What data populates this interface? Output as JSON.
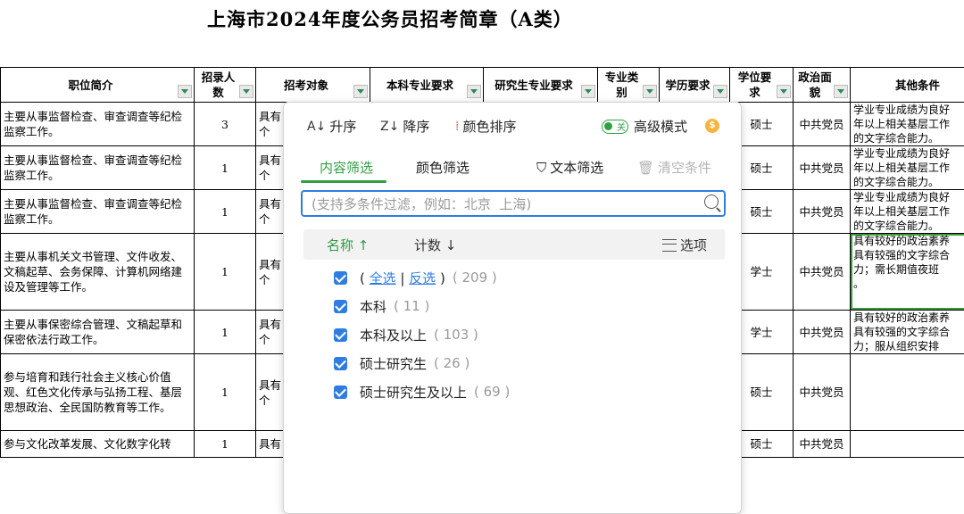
{
  "doc_title": "上海市2024年度公务员招考简章（A类）",
  "headers": [
    "职位简介",
    "招录人数",
    "招考对象",
    "本科专业要求",
    "研究生专业要求",
    "专业类别",
    "学历要求",
    "学位要求",
    "政治面貌",
    "其他条件"
  ],
  "rows": [
    {
      "desc": "主要从事监督检查、审查调查等纪检监察工作。",
      "num": "3",
      "target": "具有\n个",
      "degree": "硕士",
      "party": "中共党员",
      "other": "学业专业成绩为良好\n年以上相关基层工作\n的文字综合能力。"
    },
    {
      "desc": "主要从事监督检查、审查调查等纪检监察工作。",
      "num": "1",
      "target": "具有\n个",
      "degree": "硕士",
      "party": "中共党员",
      "other": "学业专业成绩为良好\n年以上相关基层工作\n的文字综合能力。"
    },
    {
      "desc": "主要从事监督检查、审查调查等纪检监察工作。",
      "num": "1",
      "target": "具有\n个",
      "degree": "硕士",
      "party": "中共党员",
      "other": "学业专业成绩为良好\n年以上相关基层工作\n的文字综合能力。"
    },
    {
      "desc": "主要从事机关文书管理、文件收发、文稿起草、会务保障、计算机网络建设及管理等工作。",
      "num": "1",
      "target": "具有\n个",
      "degree": "学士",
      "party": "中共党员",
      "other": "具有较好的政治素养\n具有较强的文字综合\n力；需长期值夜班\n。"
    },
    {
      "desc": "主要从事保密综合管理、文稿起草和保密依法行政工作。",
      "num": "1",
      "target": "具有\n个",
      "degree": "学士",
      "party": "中共党员",
      "other": "具有较好的政治素养\n具有较强的文字综合\n力；服从组织安排"
    },
    {
      "desc": "参与培育和践行社会主义核心价值观、红色文化传承与弘扬工程、基层思想政治、全民国防教育等工作。",
      "num": "1",
      "target": "具有\n个",
      "degree": "硕士",
      "party": "中共党员",
      "other": ""
    },
    {
      "desc": "参与文化改革发展、文化数字化转",
      "num": "1",
      "target": "具有",
      "degree": "硕士",
      "party": "中共党员",
      "other": ""
    }
  ],
  "popup": {
    "sort_asc": "升序",
    "sort_desc": "降序",
    "sort_color": "颜色排序",
    "toggle_text": "关",
    "advanced_mode": "高级模式",
    "tab_content": "内容筛选",
    "tab_color": "颜色筛选",
    "text_filter": "文本筛选",
    "clear": "清空条件",
    "search_placeholder": "(支持多条件过滤，例如：北京  上海)",
    "col_name": "名称",
    "col_count": "计数",
    "options": "选项",
    "select_all": "全选",
    "invert": "反选",
    "total": "( 209 )",
    "items": [
      {
        "label": "本科",
        "count": "( 11 )"
      },
      {
        "label": "本科及以上",
        "count": "( 103 )"
      },
      {
        "label": "硕士研究生",
        "count": "( 26 )"
      },
      {
        "label": "硕士研究生及以上",
        "count": "( 69 )"
      }
    ]
  },
  "colors": {
    "accent_green": "#2f9e44",
    "accent_blue": "#2f7de1"
  }
}
